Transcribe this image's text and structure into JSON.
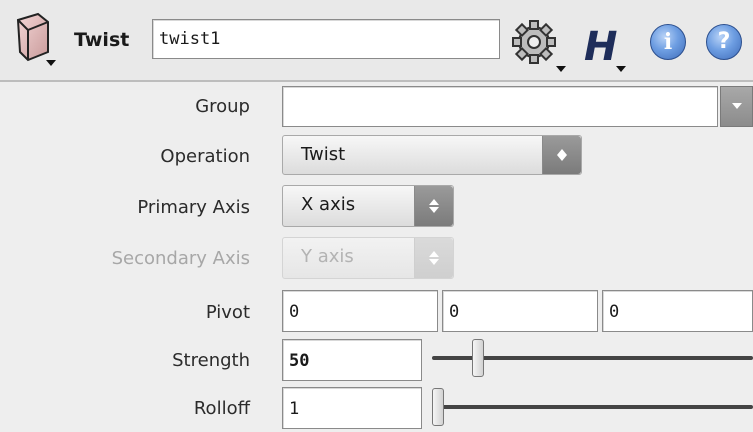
{
  "header": {
    "node_type_label": "Twist",
    "node_name_value": "twist1",
    "icons": [
      "node-shader-icon",
      "gear-icon",
      "houdini-h-icon",
      "info-icon",
      "help-icon"
    ],
    "info_glyph": "i",
    "help_glyph": "?"
  },
  "params": {
    "group": {
      "label": "Group",
      "value": ""
    },
    "operation": {
      "label": "Operation",
      "value": "Twist"
    },
    "primary_axis": {
      "label": "Primary Axis",
      "value": "X axis"
    },
    "secondary_axis": {
      "label": "Secondary Axis",
      "value": "Y axis",
      "disabled": true
    },
    "pivot": {
      "label": "Pivot",
      "x": "0",
      "y": "0",
      "z": "0"
    },
    "strength": {
      "label": "Strength",
      "value": "50",
      "slider_fraction": 0.13
    },
    "rolloff": {
      "label": "Rolloff",
      "value": "1",
      "slider_fraction": 0.0
    }
  },
  "colors": {
    "accent_blue": "#3e6bb8",
    "disabled_text": "#a7a7a7"
  }
}
